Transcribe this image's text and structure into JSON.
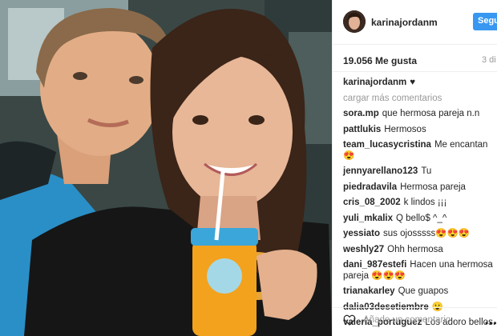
{
  "post": {
    "username": "karinajordanm",
    "follow_label": "Seguir",
    "likes": "19.056 Me gusta",
    "time": "3 di",
    "caption_user": "karinajordanm",
    "caption_text": "♥",
    "load_more": "cargar más comentarios",
    "comments": [
      {
        "user": "sora.mp",
        "text": "que hermosa pareja n.n"
      },
      {
        "user": "pattlukis",
        "text": "Hermosos"
      },
      {
        "user": "team_lucasycristina",
        "text": "Me encantan 😍"
      },
      {
        "user": "jennyarellano123",
        "text": "Tu"
      },
      {
        "user": "piedradavila",
        "text": "Hermosa pareja"
      },
      {
        "user": "cris_08_2002",
        "text": "k lindos ¡¡¡"
      },
      {
        "user": "yuli_mkalix",
        "text": "Q bello$ ^_^"
      },
      {
        "user": "yessiato",
        "text": "sus ojosssss😍😍😍"
      },
      {
        "user": "weshly27",
        "text": "Ohh hermosa"
      },
      {
        "user": "dani_987estefi",
        "text": "Hacen una hermosa pareja 😍😍😍"
      },
      {
        "user": "trianakarley",
        "text": "Que guapos"
      },
      {
        "user": "dalia03desetiembre",
        "text": "😮"
      },
      {
        "user": "valeria_portuguez",
        "text": "Los adoro bellos."
      }
    ],
    "add_comment_placeholder": "Añade un comentario...",
    "more_label": "•••"
  },
  "colors": {
    "accent": "#3897f0",
    "muted": "#999999",
    "text": "#262626"
  },
  "icons": {
    "like": "heart-outline-icon",
    "more": "more-options-icon"
  }
}
